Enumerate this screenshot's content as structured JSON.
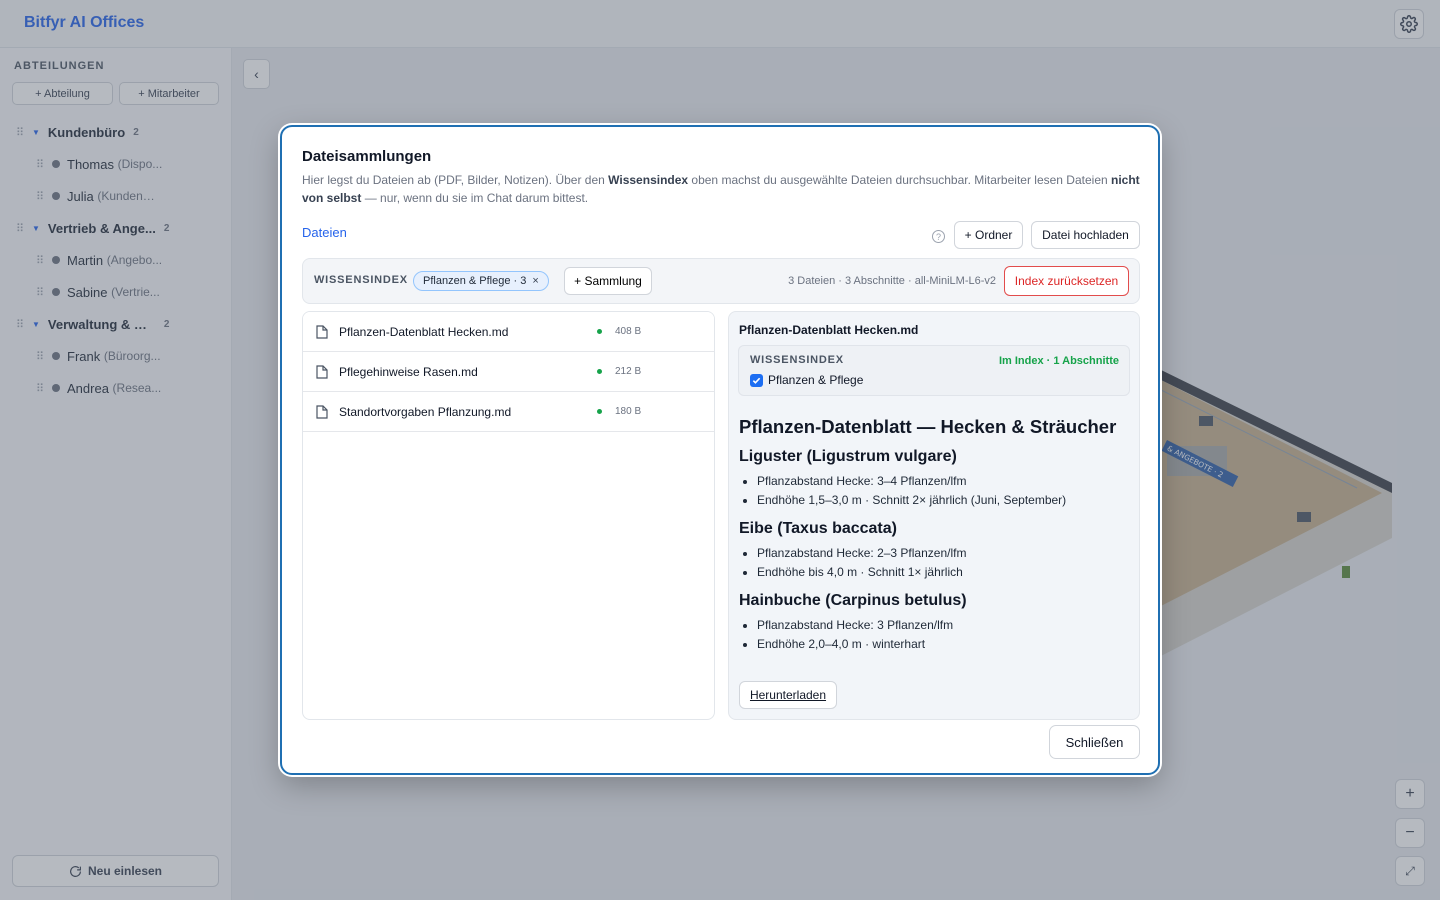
{
  "app": {
    "title": "Bitfyr AI Offices"
  },
  "sidebar": {
    "heading": "ABTEILUNGEN",
    "add_department": "+ Abteilung",
    "add_employee": "+ Mitarbeiter",
    "departments": [
      {
        "name": "Kundenbüro",
        "count": "2",
        "employees": [
          {
            "name": "Thomas",
            "role": "(Dispo..."
          },
          {
            "name": "Julia",
            "role": "(Kundenb..."
          }
        ]
      },
      {
        "name": "Vertrieb & Ange...",
        "count": "2",
        "employees": [
          {
            "name": "Martin",
            "role": "(Angebo..."
          },
          {
            "name": "Sabine",
            "role": "(Vertrie..."
          }
        ]
      },
      {
        "name": "Verwaltung & W...",
        "count": "2",
        "employees": [
          {
            "name": "Frank",
            "role": "(Büroorg..."
          },
          {
            "name": "Andrea",
            "role": "(Resea..."
          }
        ]
      }
    ],
    "reload": "Neu einlesen"
  },
  "canvas": {
    "collapse": "‹",
    "zoom_in": "+",
    "zoom_out": "−",
    "fit": "⤢",
    "room_sign": "& ANGEBOTE · 2"
  },
  "modal": {
    "title": "Dateisammlungen",
    "desc_1": "Hier legst du Dateien ab (PDF, Bilder, Notizen). Über den ",
    "desc_b1": "Wissensindex",
    "desc_2": " oben machst du ausgewählte Dateien durchsuchbar. Mitarbeiter lesen Dateien ",
    "desc_b2": "nicht von selbst",
    "desc_3": " — nur, wenn du sie im Chat darum bittest.",
    "tab_files": "Dateien",
    "help": "?",
    "add_folder": "+ Ordner",
    "upload": "Datei hochladen",
    "index": {
      "label": "WISSENSINDEX",
      "chip": "Pflanzen & Pflege · 3",
      "chip_remove": "×",
      "add_collection": "+ Sammlung",
      "stats": "3 Dateien · 3 Abschnitte · all-MiniLM-L6-v2",
      "reset": "Index zurücksetzen"
    },
    "files": [
      {
        "name": "Pflanzen-Datenblatt Hecken.md",
        "size": "408 B"
      },
      {
        "name": "Pflegehinweise Rasen.md",
        "size": "212 B"
      },
      {
        "name": "Standortvorgaben Pflanzung.md",
        "size": "180 B"
      }
    ],
    "detail": {
      "title": "Pflanzen-Datenblatt Hecken.md",
      "index_label": "WISSENSINDEX",
      "index_status": "Im Index · 1 Abschnitte",
      "collection": "Pflanzen & Pflege",
      "h1": "Pflanzen-Datenblatt — Hecken & Sträucher",
      "sections": [
        {
          "heading": "Liguster (Ligustrum vulgare)",
          "items": [
            "Pflanzabstand Hecke: 3–4 Pflanzen/lfm",
            "Endhöhe 1,5–3,0 m · Schnitt 2× jährlich (Juni, September)"
          ]
        },
        {
          "heading": "Eibe (Taxus baccata)",
          "items": [
            "Pflanzabstand Hecke: 2–3 Pflanzen/lfm",
            "Endhöhe bis 4,0 m · Schnitt 1× jährlich"
          ]
        },
        {
          "heading": "Hainbuche (Carpinus betulus)",
          "items": [
            "Pflanzabstand Hecke: 3 Pflanzen/lfm",
            "Endhöhe 2,0–4,0 m · winterhart"
          ]
        }
      ],
      "download": "Herunterladen"
    },
    "close": "Schließen"
  },
  "colors": {
    "accent": "#2563eb",
    "success": "#16a34a",
    "danger": "#dc2626",
    "modal_border": "#1f6fb2"
  }
}
